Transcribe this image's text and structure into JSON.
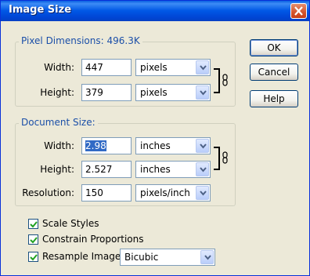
{
  "window": {
    "title": "Image Size"
  },
  "pixel_dimensions": {
    "legend": "Pixel Dimensions:",
    "size_value": "496.3K",
    "width": {
      "label": "Width:",
      "value": "447",
      "unit": "pixels"
    },
    "height": {
      "label": "Height:",
      "value": "379",
      "unit": "pixels"
    }
  },
  "document_size": {
    "legend": "Document Size:",
    "width": {
      "label": "Width:",
      "value": "2.98",
      "unit": "inches"
    },
    "height": {
      "label": "Height:",
      "value": "2.527",
      "unit": "inches"
    },
    "resolution": {
      "label": "Resolution:",
      "value": "150",
      "unit": "pixels/inch"
    }
  },
  "buttons": {
    "ok": "OK",
    "cancel": "Cancel",
    "help": "Help"
  },
  "options": {
    "scale_styles": {
      "label": "Scale Styles",
      "checked": true
    },
    "constrain_proportions": {
      "label": "Constrain Proportions",
      "checked": true
    },
    "resample_image": {
      "label": "Resample Image:",
      "checked": true,
      "method": "Bicubic"
    }
  },
  "colors": {
    "legend": "#1b4fa8",
    "title_bar": "#0058e6",
    "selection": "#316ac5"
  }
}
